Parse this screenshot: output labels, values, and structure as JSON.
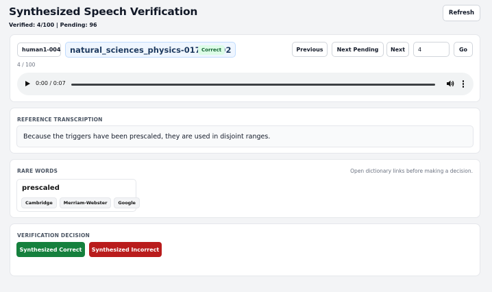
{
  "header": {
    "title": "Synthesized Speech Verification",
    "counts": "Verified: 4/100 | Pending: 96",
    "refresh_label": "Refresh"
  },
  "item": {
    "speaker_id": "human1-004",
    "file_id": "natural_sciences_physics-017-03092",
    "status": "Correct",
    "progress": "4 / 100"
  },
  "nav": {
    "previous_label": "Previous",
    "next_pending_label": "Next Pending",
    "next_label": "Next",
    "goto_value": "4",
    "go_label": "Go"
  },
  "audio": {
    "time": "0:00 / 0:07",
    "progress_fraction": 0
  },
  "reference": {
    "label": "REFERENCE TRANSCRIPTION",
    "text": "Because the triggers have been prescaled, they are used in disjoint ranges."
  },
  "rare_words": {
    "label": "RARE WORDS",
    "hint": "Open dictionary links before making a decision.",
    "items": [
      {
        "word": "prescaled",
        "links": [
          "Cambridge",
          "Merriam-Webster",
          "Google"
        ]
      }
    ]
  },
  "decision": {
    "label": "VERIFICATION DECISION",
    "correct_label": "Synthesized Correct",
    "incorrect_label": "Synthesized Incorrect"
  },
  "colors": {
    "correct": "#15803d",
    "incorrect": "#b91c1c",
    "status_bg": "#dcfce7",
    "file_chip_bg": "#eff6ff"
  }
}
